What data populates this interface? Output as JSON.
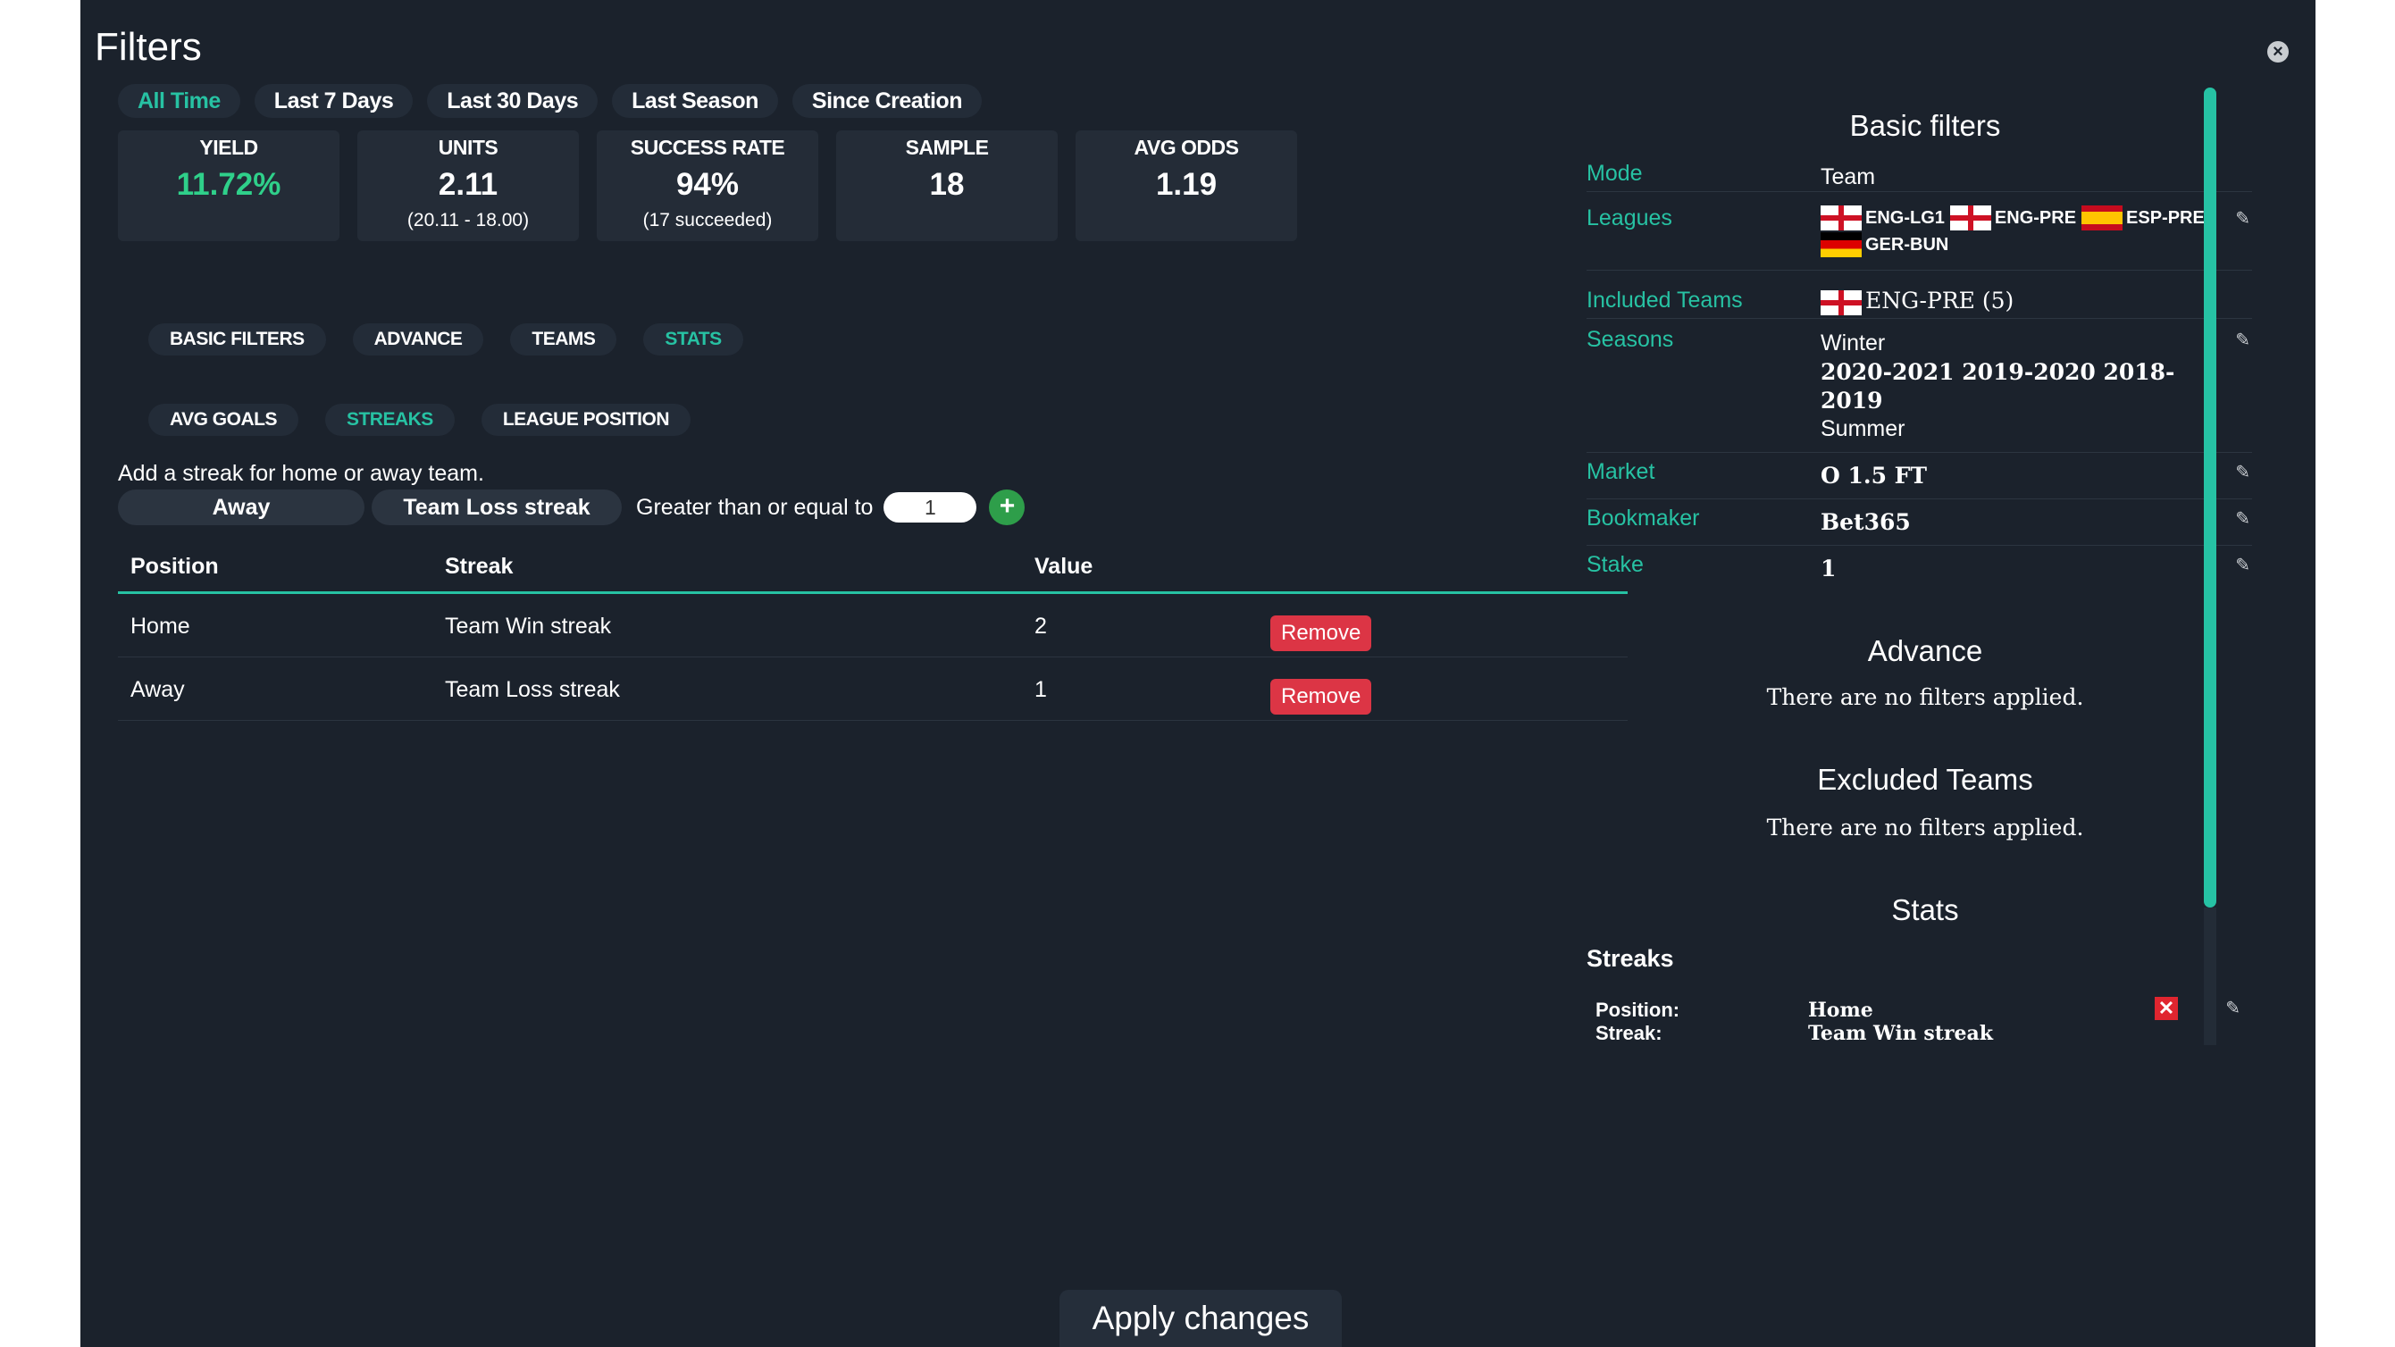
{
  "header": {
    "title": "Filters",
    "close_label": "×"
  },
  "time_tabs": [
    {
      "label": "All Time",
      "active": true
    },
    {
      "label": "Last 7 Days",
      "active": false
    },
    {
      "label": "Last 30 Days",
      "active": false
    },
    {
      "label": "Last Season",
      "active": false
    },
    {
      "label": "Since Creation",
      "active": false
    }
  ],
  "summary": {
    "yield": {
      "label": "YIELD",
      "value": "11.72%"
    },
    "units": {
      "label": "UNITS",
      "value": "2.11",
      "sub": "(20.11 - 18.00)"
    },
    "success_rate": {
      "label": "SUCCESS RATE",
      "value": "94%",
      "sub": "(17 succeeded)"
    },
    "sample": {
      "label": "SAMPLE",
      "value": "18"
    },
    "avg_odds": {
      "label": "AVG ODDS",
      "value": "1.19"
    }
  },
  "section_tabs": [
    {
      "label": "BASIC FILTERS",
      "active": false
    },
    {
      "label": "ADVANCE",
      "active": false
    },
    {
      "label": "TEAMS",
      "active": false
    },
    {
      "label": "STATS",
      "active": true
    }
  ],
  "stats_tabs": [
    {
      "label": "AVG GOALS",
      "active": false
    },
    {
      "label": "STREAKS",
      "active": true
    },
    {
      "label": "LEAGUE POSITION",
      "active": false
    }
  ],
  "streak_form": {
    "info": "Add a streak for home or away team.",
    "position": "Away",
    "streak_type": "Team Loss streak",
    "comparator": "Greater than or equal to",
    "value": "1",
    "add_label": "+"
  },
  "streak_table": {
    "headers": [
      "Position",
      "Streak",
      "Value"
    ],
    "rows": [
      {
        "position": "Home",
        "streak": "Team Win streak",
        "value": "2",
        "remove_label": "Remove"
      },
      {
        "position": "Away",
        "streak": "Team Loss streak",
        "value": "1",
        "remove_label": "Remove"
      }
    ]
  },
  "right_panel": {
    "basic_title": "Basic filters",
    "mode": {
      "label": "Mode",
      "value": "Team"
    },
    "leagues": {
      "label": "Leagues",
      "items": [
        "ENG-LG1",
        "ENG-PRE",
        "ESP-PRE",
        "GER-BUN"
      ]
    },
    "included_teams": {
      "label": "Included Teams",
      "value": "ENG-PRE (5)"
    },
    "seasons": {
      "label": "Seasons",
      "line1": "Winter",
      "line2": "2020-2021 2019-2020 2018-",
      "line3": "2019",
      "line4": "Summer"
    },
    "market": {
      "label": "Market",
      "value": "O 1.5 FT"
    },
    "bookmaker": {
      "label": "Bookmaker",
      "value": "Bet365"
    },
    "stake": {
      "label": "Stake",
      "value": "1"
    },
    "advance_title": "Advance",
    "advance_text": "There are no filters applied.",
    "excluded_title": "Excluded Teams",
    "excluded_text": "There are no filters applied.",
    "stats_title": "Stats",
    "streaks_heading": "Streaks",
    "streak_item": {
      "position_label": "Position:",
      "streak_label": "Streak:",
      "position": "Home",
      "streak": "Team Win streak",
      "delete_label": "✕"
    }
  },
  "footer": {
    "apply_label": "Apply changes"
  },
  "colors": {
    "accent": "#27c2a3",
    "remove": "#dc3545",
    "background": "#1b222c",
    "yield_green": "#2fd08a"
  }
}
